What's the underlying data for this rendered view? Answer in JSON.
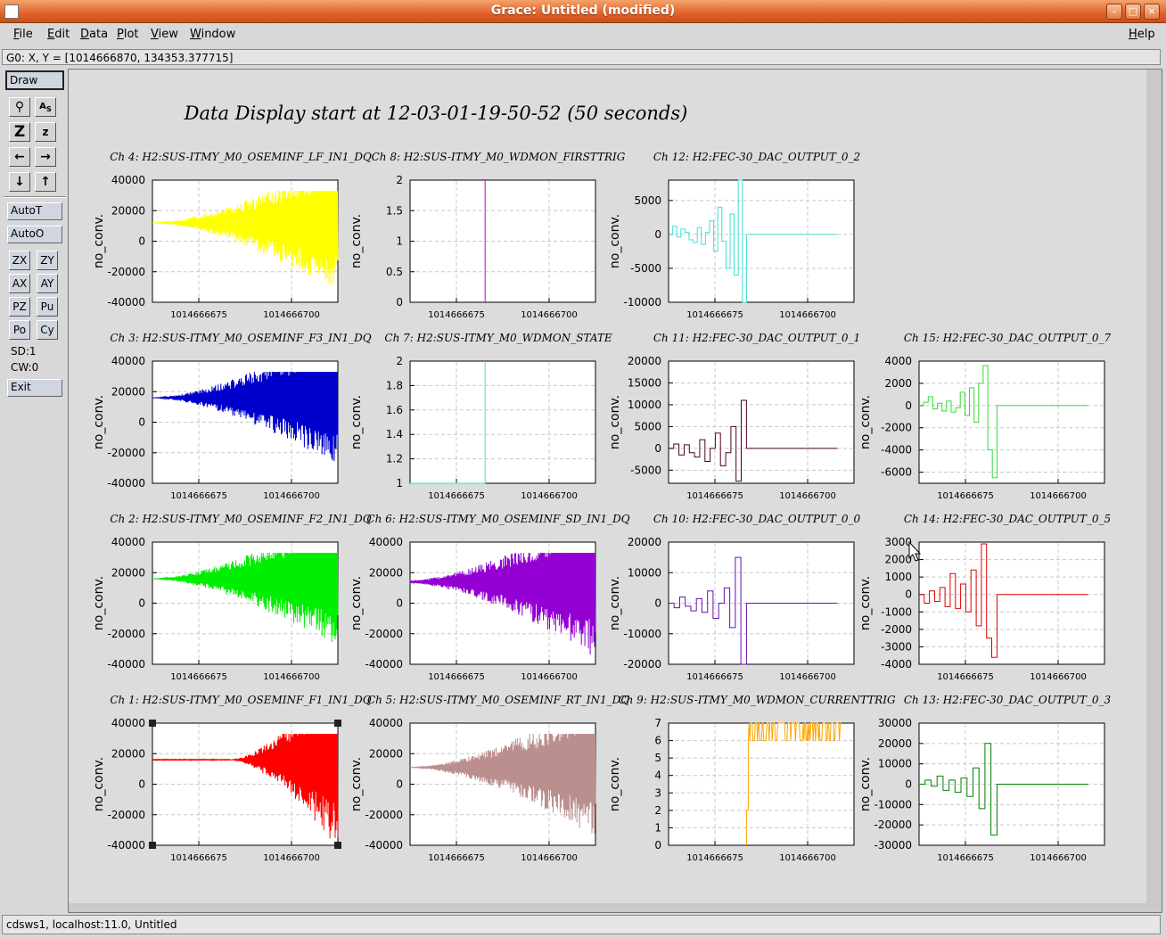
{
  "window": {
    "title": "Grace: Untitled (modified)"
  },
  "menubar": {
    "items": [
      "File",
      "Edit",
      "Data",
      "Plot",
      "View",
      "Window"
    ],
    "help": "Help"
  },
  "locator": "G0: X, Y = [1014666870, 134353.377715]",
  "toolbar": {
    "draw": "Draw",
    "autot": "AutoT",
    "autoo": "AutoO",
    "grid_buttons": [
      [
        "ZX",
        "ZY"
      ],
      [
        "AX",
        "AY"
      ],
      [
        "PZ",
        "Pu"
      ],
      [
        "Po",
        "Cy"
      ]
    ],
    "sd": "SD:1",
    "cw": "CW:0",
    "exit": "Exit"
  },
  "statusbar": "cdsws1, localhost:11.0, Untitled",
  "chart_data": {
    "title": "Data Display start at 12-03-01-19-50-52 (50 seconds)",
    "ylabel": "no_conv.",
    "x_ticks": [
      "1014666675",
      "1014666700"
    ],
    "graphs": [
      {
        "title": "Ch 4: H2:SUS-ITMY_M0_OSEMINF_LF_IN1_DQ",
        "type": "line",
        "color": "#ffff00",
        "ylim": [
          -40000,
          40000
        ],
        "yticks": [
          "40000",
          "20000",
          "0",
          "-20000",
          "-40000"
        ],
        "pattern": "oscillation",
        "baseline": 12000,
        "amplitude": [
          0,
          46000
        ],
        "saturate": [
          -33000,
          33000
        ]
      },
      {
        "title": "Ch 8: H2:SUS-ITMY_M0_WDMON_FIRSTTRIG",
        "type": "line",
        "color": "#cc00cc",
        "ylim": [
          0,
          2
        ],
        "yticks": [
          "2",
          "1.5",
          "1",
          "0.5",
          "0"
        ],
        "pattern": "step",
        "level_from": 0,
        "level_to": 2,
        "step_at": 0.405
      },
      {
        "title": "Ch 12: H2:FEC-30_DAC_OUTPUT_0_2",
        "type": "line",
        "color": "#40e0d0",
        "ylim": [
          -10000,
          8000
        ],
        "yticks": [
          "5000",
          "0",
          "-5000",
          "-10000"
        ],
        "pattern": "staircase",
        "values": [
          0,
          1200,
          -400,
          800,
          300,
          -800,
          -1200,
          1000,
          -1500,
          300,
          2000,
          -2500,
          4000,
          -1000,
          -5000,
          3000,
          -6000,
          8000,
          -11000,
          0
        ]
      },
      {
        "title": "",
        "type": "empty"
      },
      {
        "title": "Ch 3: H2:SUS-ITMY_M0_OSEMINF_F3_IN1_DQ",
        "type": "line",
        "color": "#0000cc",
        "ylim": [
          -40000,
          40000
        ],
        "yticks": [
          "40000",
          "20000",
          "0",
          "-20000",
          "-40000"
        ],
        "pattern": "oscillation",
        "baseline": 16000,
        "amplitude": [
          0,
          46000
        ],
        "saturate": [
          -33000,
          33000
        ]
      },
      {
        "title": "Ch 7: H2:SUS-ITMY_M0_WDMON_STATE",
        "type": "line",
        "color": "#40e0d0",
        "ylim": [
          1,
          2
        ],
        "yticks": [
          "2",
          "1.8",
          "1.6",
          "1.4",
          "1.2",
          "1"
        ],
        "pattern": "step",
        "level_from": 1,
        "level_to": 2,
        "step_at": 0.405
      },
      {
        "title": "Ch 11: H2:FEC-30_DAC_OUTPUT_0_1",
        "type": "line",
        "color": "#500028",
        "ylim": [
          -8000,
          20000
        ],
        "yticks": [
          "20000",
          "15000",
          "10000",
          "5000",
          "0",
          "-5000"
        ],
        "pattern": "staircase",
        "values": [
          0,
          1000,
          -1500,
          800,
          -1000,
          -2000,
          2000,
          -3000,
          0,
          3500,
          -4000,
          -1000,
          5000,
          -7500,
          11000,
          0
        ]
      },
      {
        "title": "Ch 15: H2:FEC-30_DAC_OUTPUT_0_7",
        "type": "line",
        "color": "#33dd33",
        "ylim": [
          -7000,
          4000
        ],
        "yticks": [
          "4000",
          "2000",
          "0",
          "-2000",
          "-4000",
          "-6000"
        ],
        "pattern": "staircase",
        "values": [
          0,
          300,
          800,
          -300,
          200,
          -500,
          400,
          -600,
          -200,
          1200,
          -900,
          1600,
          -1500,
          2000,
          3600,
          -4000,
          -6500,
          0
        ]
      },
      {
        "title": "Ch 2: H2:SUS-ITMY_M0_OSEMINF_F2_IN1_DQ",
        "type": "line",
        "color": "#00ee00",
        "ylim": [
          -40000,
          40000
        ],
        "yticks": [
          "40000",
          "20000",
          "0",
          "-20000",
          "-40000"
        ],
        "pattern": "oscillation",
        "baseline": 16000,
        "amplitude": [
          0,
          46000
        ],
        "saturate": [
          -33000,
          33000
        ]
      },
      {
        "title": "Ch 6: H2:SUS-ITMY_M0_OSEMINF_SD_IN1_DQ",
        "type": "line",
        "color": "#9400d3",
        "ylim": [
          -40000,
          40000
        ],
        "yticks": [
          "40000",
          "20000",
          "0",
          "-20000",
          "-40000"
        ],
        "pattern": "oscillation",
        "baseline": 14000,
        "amplitude": [
          1000,
          50000
        ],
        "saturate": [
          -33000,
          33000
        ]
      },
      {
        "title": "Ch 10: H2:FEC-30_DAC_OUTPUT_0_0",
        "type": "line",
        "color": "#6a0dad",
        "ylim": [
          -20000,
          20000
        ],
        "yticks": [
          "20000",
          "10000",
          "0",
          "-10000",
          "-20000"
        ],
        "pattern": "staircase",
        "values": [
          0,
          -1500,
          2000,
          -1000,
          -2500,
          1500,
          -3000,
          4000,
          -5000,
          0,
          5000,
          -8000,
          15000,
          -20000,
          0
        ]
      },
      {
        "title": "Ch 14: H2:FEC-30_DAC_OUTPUT_0_5",
        "type": "line",
        "color": "#dd0000",
        "ylim": [
          -4000,
          3000
        ],
        "yticks": [
          "3000",
          "2000",
          "1000",
          "0",
          "-1000",
          "-2000",
          "-3000",
          "-4000"
        ],
        "pattern": "staircase",
        "values": [
          0,
          -500,
          200,
          -400,
          400,
          -700,
          1200,
          -800,
          600,
          -1000,
          1400,
          -1800,
          2900,
          -2500,
          -3600,
          0
        ]
      },
      {
        "title": "Ch 1: H2:SUS-ITMY_M0_OSEMINF_F1_IN1_DQ",
        "type": "line",
        "color": "#ff0000",
        "ylim": [
          -40000,
          40000
        ],
        "yticks": [
          "40000",
          "20000",
          "0",
          "-20000",
          "-40000"
        ],
        "pattern": "oscillation",
        "baseline": 16000,
        "amplitude": [
          0,
          60000
        ],
        "saturate": [
          -33000,
          33000
        ],
        "onset": 0.42
      },
      {
        "title": "Ch 5: H2:SUS-ITMY_M0_OSEMINF_RT_IN1_DQ",
        "type": "line",
        "color": "#bc8f8f",
        "ylim": [
          -40000,
          40000
        ],
        "yticks": [
          "40000",
          "20000",
          "0",
          "-20000",
          "-40000"
        ],
        "pattern": "oscillation",
        "baseline": 11000,
        "amplitude": [
          0,
          46000
        ],
        "saturate": [
          -33000,
          33000
        ]
      },
      {
        "title": "Ch 9: H2:SUS-ITMY_M0_WDMON_CURRENTTRIG",
        "type": "line",
        "color": "#ffa500",
        "ylim": [
          0,
          7
        ],
        "yticks": [
          "7",
          "6",
          "5",
          "4",
          "3",
          "2",
          "1",
          "0"
        ],
        "pattern": "trig",
        "step_at": 0.42
      },
      {
        "title": "Ch 13: H2:FEC-30_DAC_OUTPUT_0_3",
        "type": "line",
        "color": "#008000",
        "ylim": [
          -30000,
          30000
        ],
        "yticks": [
          "30000",
          "20000",
          "10000",
          "0",
          "-10000",
          "-20000",
          "-30000"
        ],
        "pattern": "staircase",
        "values": [
          0,
          2000,
          -1000,
          4000,
          -3000,
          2000,
          -4000,
          3000,
          -6000,
          8000,
          -12000,
          20000,
          -25000,
          0
        ]
      }
    ]
  }
}
